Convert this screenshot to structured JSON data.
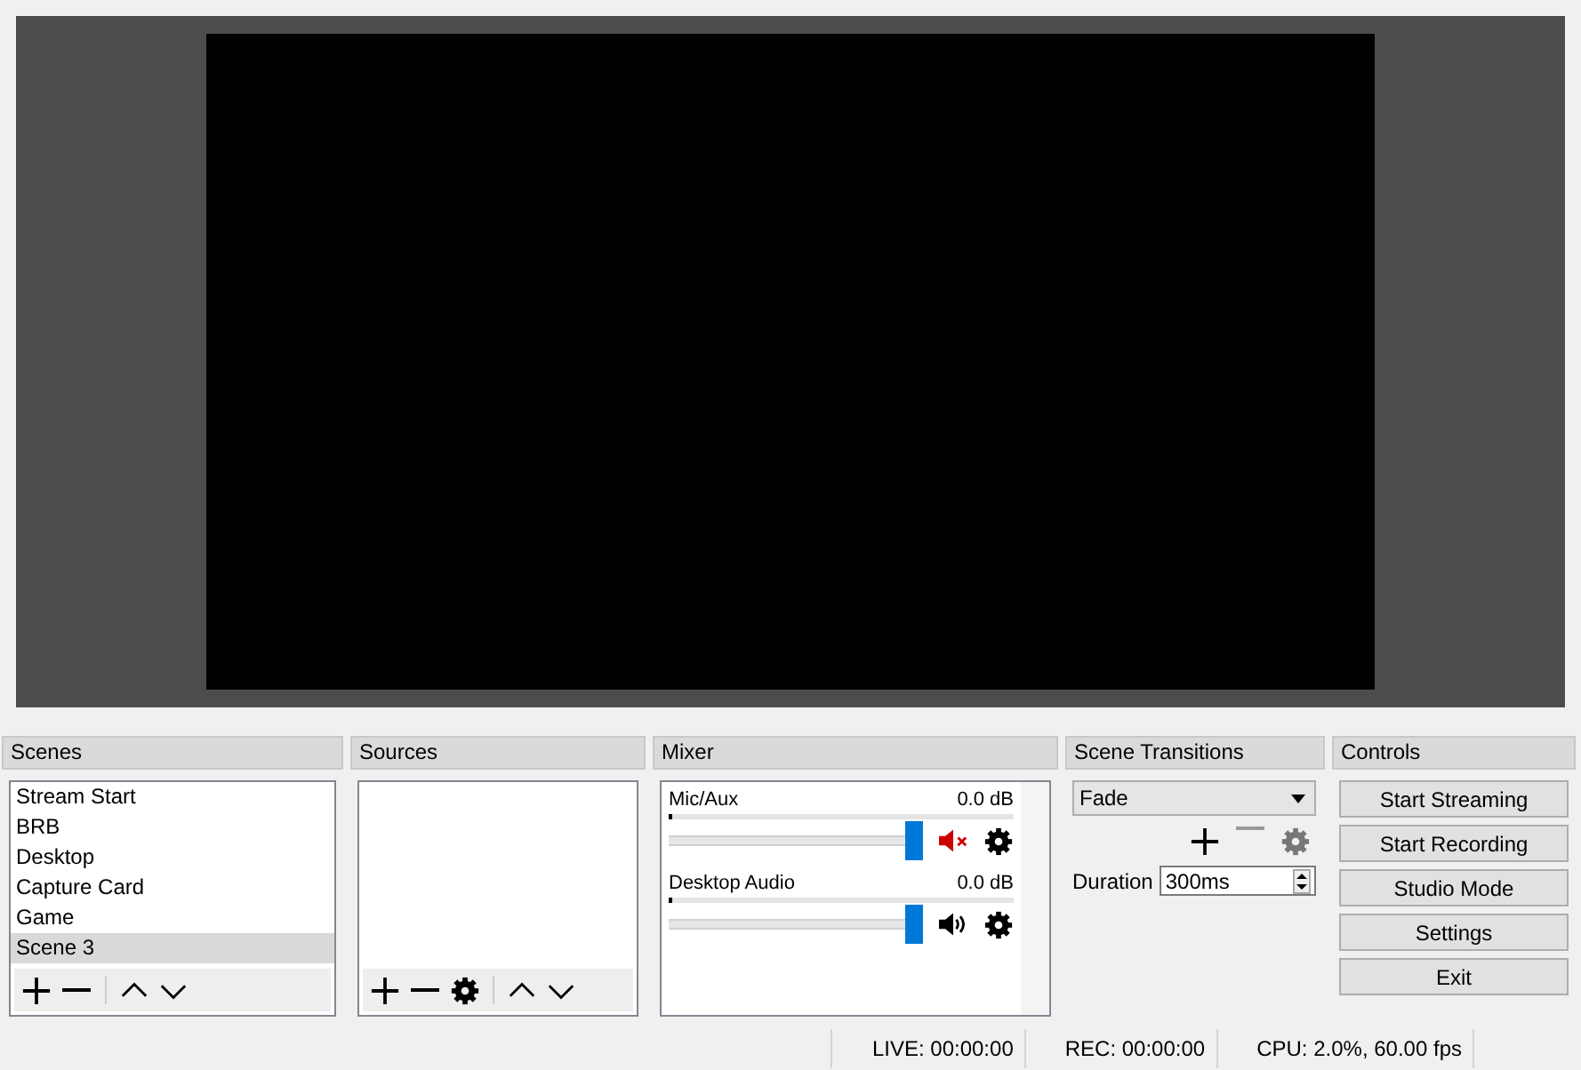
{
  "docks": {
    "scenes": "Scenes",
    "sources": "Sources",
    "mixer": "Mixer",
    "transitions": "Scene Transitions",
    "controls": "Controls"
  },
  "scenes": [
    {
      "name": "Stream Start",
      "selected": false
    },
    {
      "name": "BRB",
      "selected": false
    },
    {
      "name": "Desktop",
      "selected": false
    },
    {
      "name": "Capture Card",
      "selected": false
    },
    {
      "name": "Game",
      "selected": false
    },
    {
      "name": "Scene 3",
      "selected": true
    }
  ],
  "mixer": [
    {
      "name": "Mic/Aux",
      "reading": "0.0 dB",
      "level": 1,
      "muted": true
    },
    {
      "name": "Desktop Audio",
      "reading": "0.0 dB",
      "level": 1,
      "muted": false
    }
  ],
  "transition": {
    "value": "Fade",
    "duration_label": "Duration",
    "duration": "300ms"
  },
  "controls": [
    "Start Streaming",
    "Start Recording",
    "Studio Mode",
    "Settings",
    "Exit"
  ],
  "status_bar": [
    "LIVE: 00:00:00",
    "REC: 00:00:00",
    "CPU: 2.0%, 60.00 fps"
  ]
}
